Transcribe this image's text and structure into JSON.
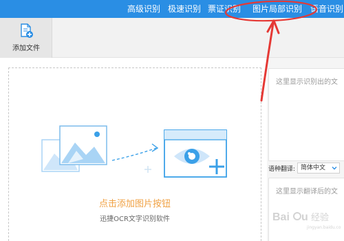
{
  "nav": {
    "tabs": [
      {
        "label": "高级识别"
      },
      {
        "label": "极速识别"
      },
      {
        "label": "票证识别"
      },
      {
        "label": "图片局部识别",
        "active": true
      },
      {
        "label": "语音识别"
      }
    ]
  },
  "toolbar": {
    "add_file_label": "添加文件"
  },
  "dropzone": {
    "title": "点击添加图片按钮",
    "subtitle": "迅捷OCR文字识别软件"
  },
  "result": {
    "placeholder": "这里显示识别出的文"
  },
  "translate": {
    "label": "语种翻译:",
    "selected": "简体中文",
    "placeholder": "这里显示翻译后的文"
  },
  "watermark": {
    "text": "Baidu 经验"
  },
  "colors": {
    "nav_bg": "#2a8ee4",
    "accent_blue": "#3aa0e8",
    "prompt_orange": "#f0a143",
    "annotation_red": "#e53935"
  }
}
